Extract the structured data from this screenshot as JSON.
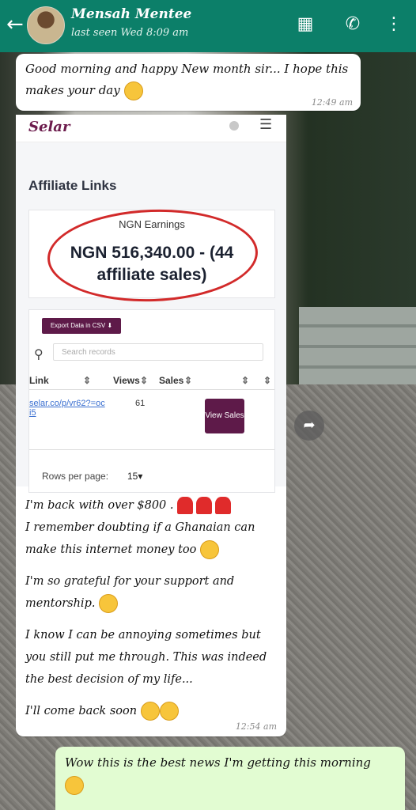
{
  "header": {
    "contact_name": "Mensah Mentee",
    "status": "last seen Wed 8:09 am"
  },
  "messages": [
    {
      "text": "Good morning and happy New month sir... I hope this makes your day",
      "time": "12:49 am"
    },
    {
      "paragraphs": [
        "I'm back with over $800 .",
        "I remember doubting if a Ghanaian can make this internet money too",
        "I'm so grateful for your support and mentorship.",
        "I know I can be annoying sometimes but you still put me through. This was indeed the best decision of my life...",
        "I'll come back soon"
      ],
      "time": "12:54 am"
    },
    {
      "text": "Wow  this is the best news I'm getting this morning"
    }
  ],
  "selar": {
    "logo": "Selar",
    "page_title": "Affiliate Links",
    "earnings_label": "NGN Earnings",
    "earnings_value": "NGN 516,340.00 - (44 affiliate sales)",
    "export_button": "Export Data in CSV",
    "search_placeholder": "Search records",
    "columns": [
      "Link",
      "Views",
      "Sales"
    ],
    "row": {
      "link": "selar.co/p/vr62?=oci5",
      "views": "61",
      "button": "View Sales"
    },
    "rows_per_page_label": "Rows per page:",
    "rows_per_page_value": "15"
  },
  "colors": {
    "header": "#0c7f69",
    "outgoing_bubble": "#e2fcd2",
    "selar_brand": "#5e1a49",
    "highlight_ring": "#d22a2a"
  }
}
